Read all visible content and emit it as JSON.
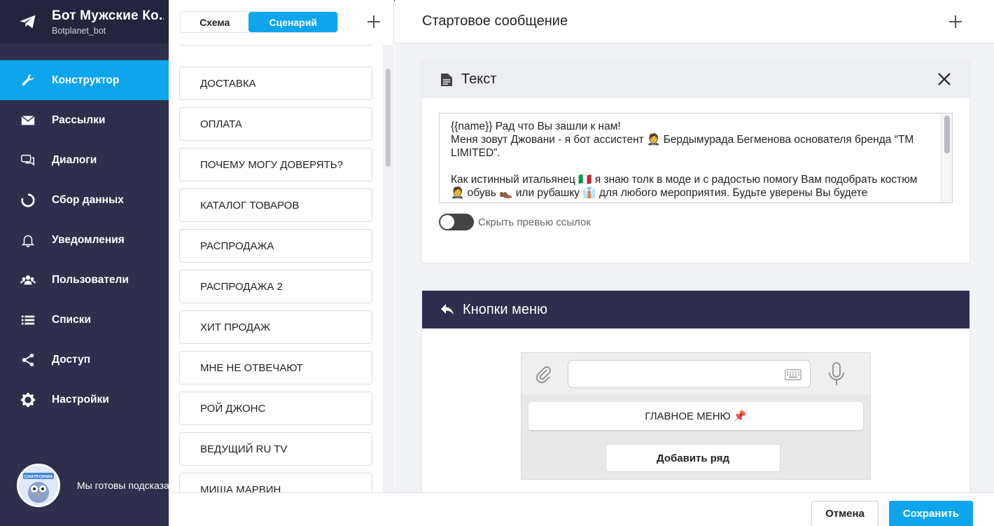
{
  "sidebar": {
    "bot_name": "Бот Мужские Ко...",
    "bot_username": "Botplanet_bot",
    "items": [
      {
        "label": "Конструктор",
        "icon": "wrench-icon",
        "active": true
      },
      {
        "label": "Рассылки",
        "icon": "envelope-icon"
      },
      {
        "label": "Диалоги",
        "icon": "chat-icon"
      },
      {
        "label": "Сбор данных",
        "icon": "circle-arrow-icon"
      },
      {
        "label": "Уведомления",
        "icon": "bell-icon"
      },
      {
        "label": "Пользователи",
        "icon": "users-icon"
      },
      {
        "label": "Списки",
        "icon": "list-icon"
      },
      {
        "label": "Доступ",
        "icon": "share-icon"
      },
      {
        "label": "Настройки",
        "icon": "gear-icon"
      }
    ],
    "helper": {
      "text": "Мы готовы подсказать!",
      "logo_text": "CHATFORMA"
    }
  },
  "middle": {
    "tabs": {
      "scheme": "Схема",
      "scenario": "Сценарий",
      "active": "scenario"
    },
    "list": [
      "ДОСТАВКА",
      "ОПЛАТА",
      "ПОЧЕМУ МОГУ ДОВЕРЯТЬ?",
      "КАТАЛОГ ТОВАРОВ",
      "РАСПРОДАЖА",
      "РАСПРОДАЖА 2",
      "ХИТ ПРОДАЖ",
      "МНЕ НЕ ОТВЕЧАЮТ",
      "РОЙ ДЖОНС",
      "ВЕДУЩИЙ RU TV",
      "МИША МАРВИН"
    ]
  },
  "right": {
    "title": "Стартовое сообщение",
    "text_card": {
      "title": "Текст",
      "message": "{{name}} Рад что Вы зашли к нам!\nМеня зовут Джовани - я бот ассистент 🤵 Бердымурада Бегменова основателя бренда “TM LIMITED”.\n\nКак истинный итальянец 🇮🇹 я знаю толк в моде и с радостью помогу Вам подобрать костюм 🤵 обувь 👞 или рубашку 👔 для любого мероприятия. Будьте уверены Вы будете",
      "toggle_label": "Скрыть превью ссылок",
      "toggle_on": false
    },
    "menu_card": {
      "title": "Кнопки меню",
      "input_value": "",
      "button_label": "ГЛАВНОЕ МЕНЮ 📌",
      "add_row_label": "Добавить ряд"
    }
  },
  "footer": {
    "cancel": "Отмена",
    "save": "Сохранить"
  },
  "colors": {
    "sidebar_bg": "#2d2f4d",
    "accent": "#0ea5ec"
  }
}
